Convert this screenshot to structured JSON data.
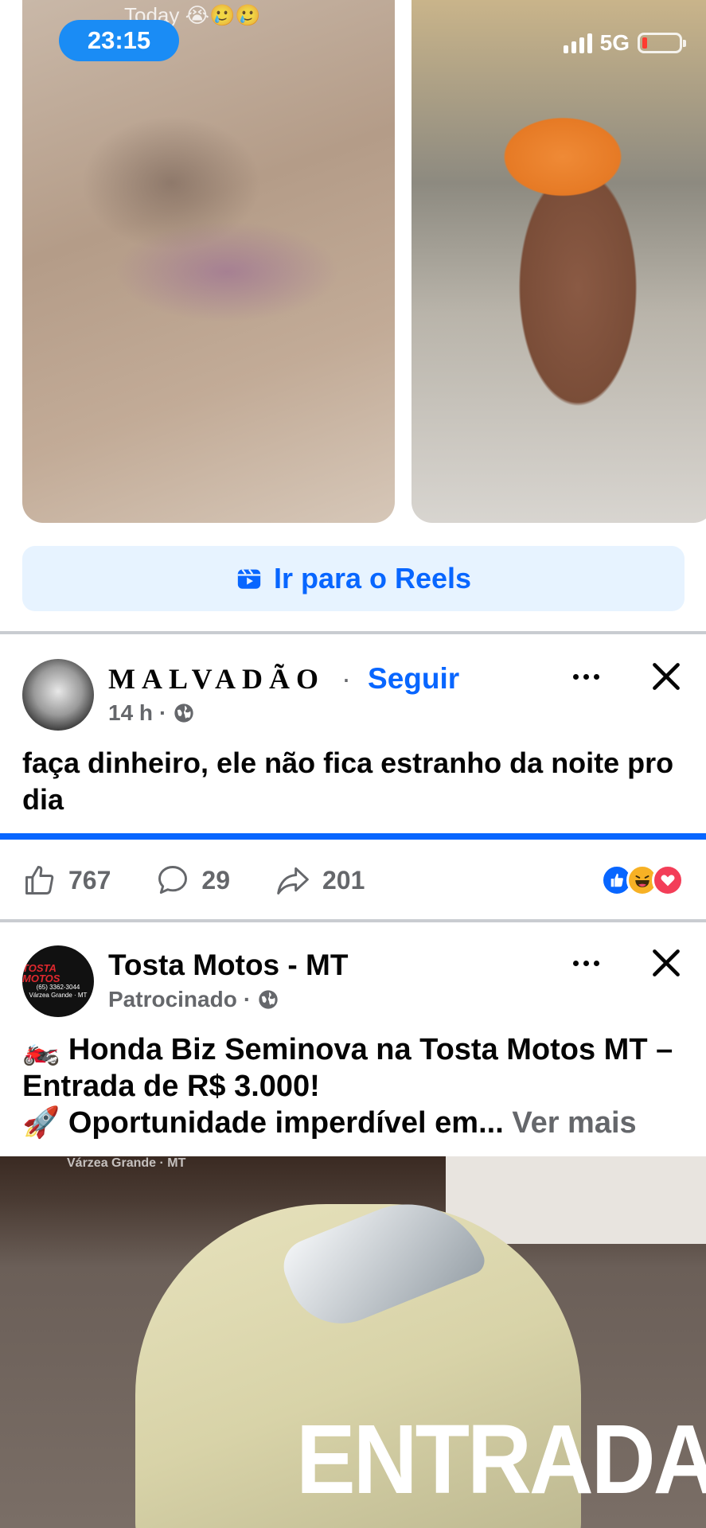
{
  "status_bar": {
    "time": "23:15",
    "network": "5G"
  },
  "reels": {
    "caption": "Today 😭🥲🥲",
    "button_label": "Ir para o Reels"
  },
  "post": {
    "author": "MALVADÃO",
    "separator": "·",
    "follow_label": "Seguir",
    "time": "14 h",
    "text": "faça dinheiro, ele não fica estranho da noite pro dia",
    "likes": "767",
    "comments": "29",
    "shares": "201"
  },
  "ad": {
    "author": "Tosta Motos - MT",
    "sponsored_label": "Patrocinado",
    "avatar_logo": "TOSTA MOTOS",
    "avatar_phone": "(65) 3362-3044",
    "avatar_city": "Várzea Grande · MT",
    "line1": "🏍️ Honda Biz Seminova na Tosta Motos MT – Entrada de R$ 3.000!",
    "line2": "🚀 Oportunidade imperdível em...",
    "see_more": "Ver mais",
    "image_location": "Várzea Grande · MT",
    "image_headline": "ENTRADA"
  },
  "colors": {
    "accent": "#0866ff",
    "reels_button_bg": "#e7f3ff",
    "secondary_text": "#65676b",
    "divider": "#c9ccd1",
    "status_time_bg": "#1a8cf5"
  },
  "icons": [
    "reels-icon",
    "globe-icon",
    "more-icon",
    "close-icon",
    "like-icon",
    "comment-icon",
    "share-icon",
    "like-reaction-icon",
    "haha-reaction-icon",
    "love-reaction-icon"
  ]
}
